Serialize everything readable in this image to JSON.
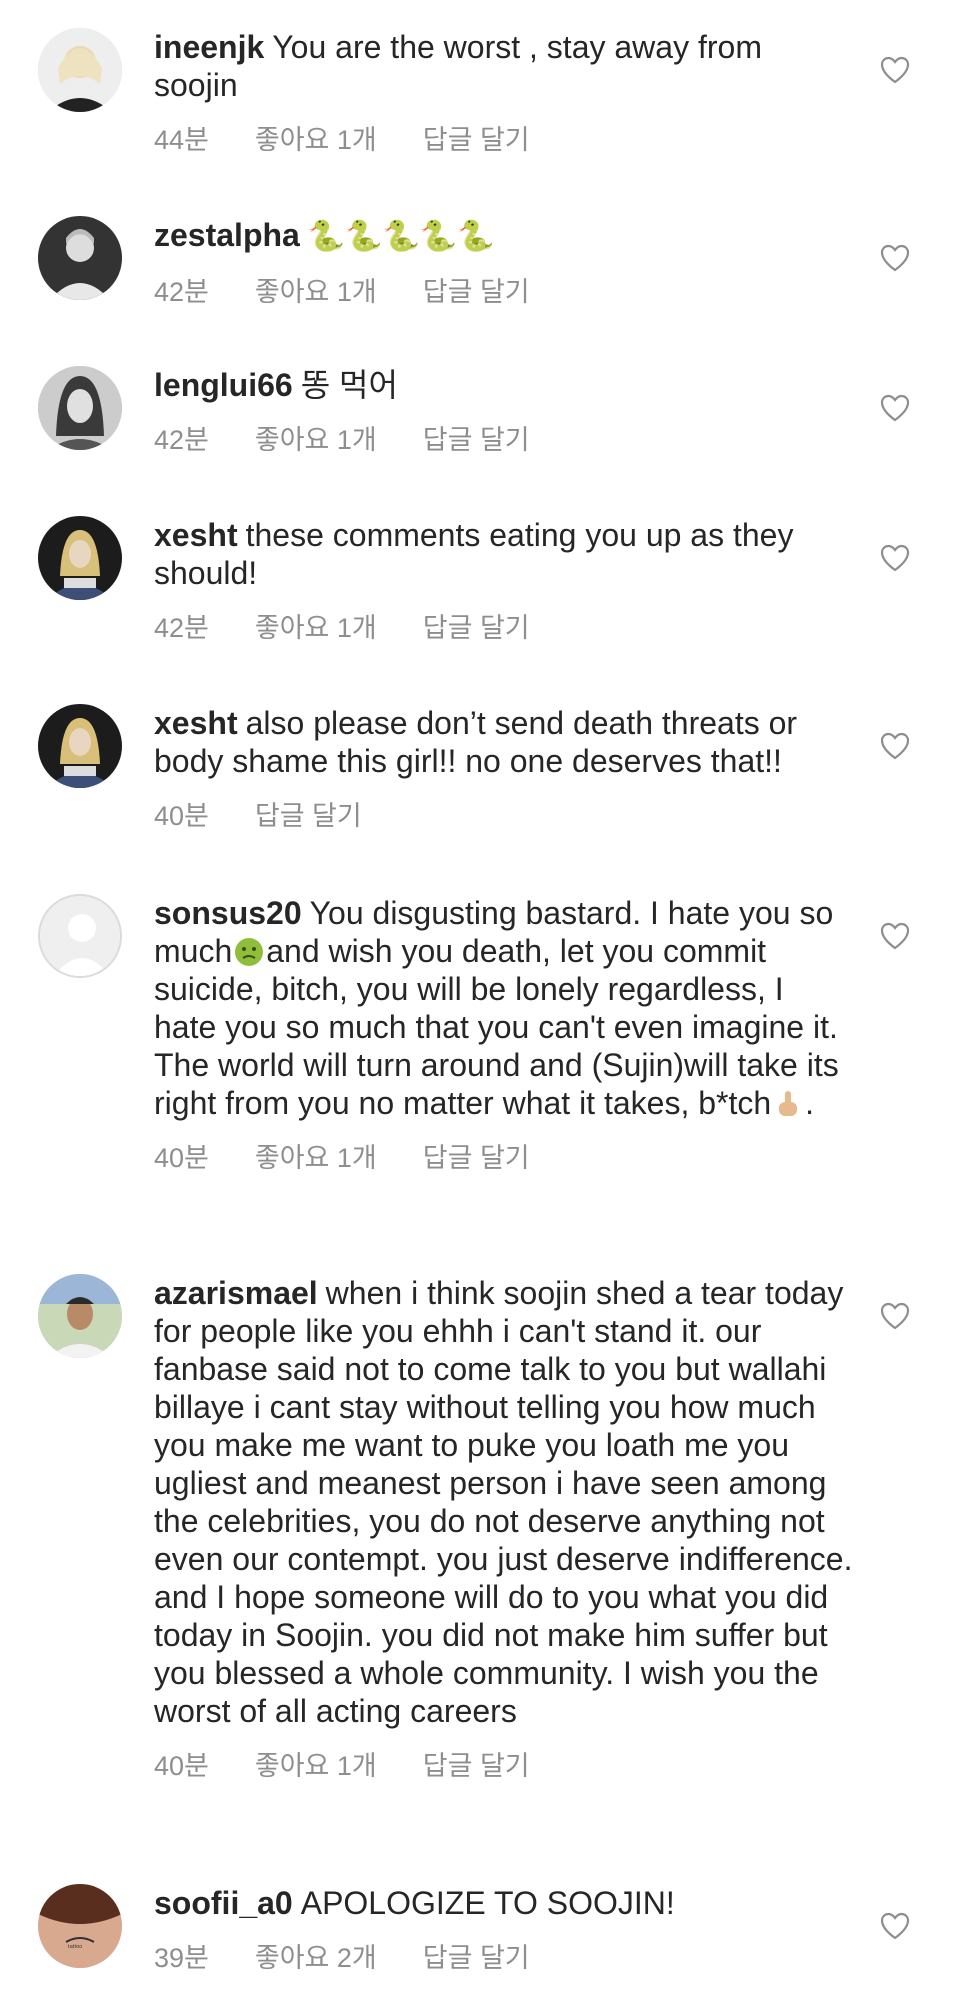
{
  "comments": [
    {
      "user": "ineenjk",
      "text": "You are the worst , stay away from soojin",
      "time": "44분",
      "likes": "좋아요 1개",
      "reply": "답글 달기",
      "avatar": "blonde-woman-avatar"
    },
    {
      "user": "zestalpha",
      "text": "🐍🐍🐍🐍🐍",
      "time": "42분",
      "likes": "좋아요 1개",
      "reply": "답글 달기",
      "avatar": "man-photo-avatar"
    },
    {
      "user": "lenglui66",
      "text": "똥 먹어",
      "time": "42분",
      "likes": "좋아요 1개",
      "reply": "답글 달기",
      "avatar": "woman-photo-avatar"
    },
    {
      "user": "xesht",
      "text": "these comments eating you up as they should!",
      "time": "42분",
      "likes": "좋아요 1개",
      "reply": "답글 달기",
      "avatar": "dark-photo-avatar"
    },
    {
      "user": "xesht",
      "text": "also please don’t send death threats or body shame this girl!! no one deserves that!!",
      "time": "40분",
      "likes": "",
      "reply": "답글 달기",
      "avatar": "dark-photo-avatar"
    },
    {
      "user": "sonsus20",
      "text_a": "You disgusting bastard.  I hate you so much",
      "text_b": "and wish you death, let you commit suicide, bitch, you will be lonely regardless, I hate you so much that you can't even imagine it. The world will turn around and (Sujin)will take its right from you no matter what it takes, b*tch",
      "text_c": ".",
      "time": "40분",
      "likes": "좋아요 1개",
      "reply": "답글 달기",
      "avatar": "default-avatar"
    },
    {
      "user": "azarismael",
      "text": "when i think soojin shed a tear today for people like you ehhh i can't stand it. our fanbase said not to come talk to you but wallahi billaye i cant stay without telling you how much you make me want to puke you loath me you ugliest and meanest person i have seen among the celebrities, you do not deserve anything not even our contempt. you just deserve indifference. and I hope someone will do to you what you did today in Soojin. you did not make him suffer but you blessed a whole community. I wish you the worst of all acting careers",
      "time": "40분",
      "likes": "좋아요 1개",
      "reply": "답글 달기",
      "avatar": "outdoor-photo-avatar"
    },
    {
      "user": "soofii_a0",
      "text": "APOLOGIZE TO SOOJIN!",
      "time": "39분",
      "likes": "좋아요 2개",
      "reply": "답글 달기",
      "avatar": "tattoo-photo-avatar"
    }
  ],
  "colors": {
    "text": "#262626",
    "meta": "#8e8e8e",
    "heart": "#8e8e8e",
    "background": "#ffffff"
  }
}
